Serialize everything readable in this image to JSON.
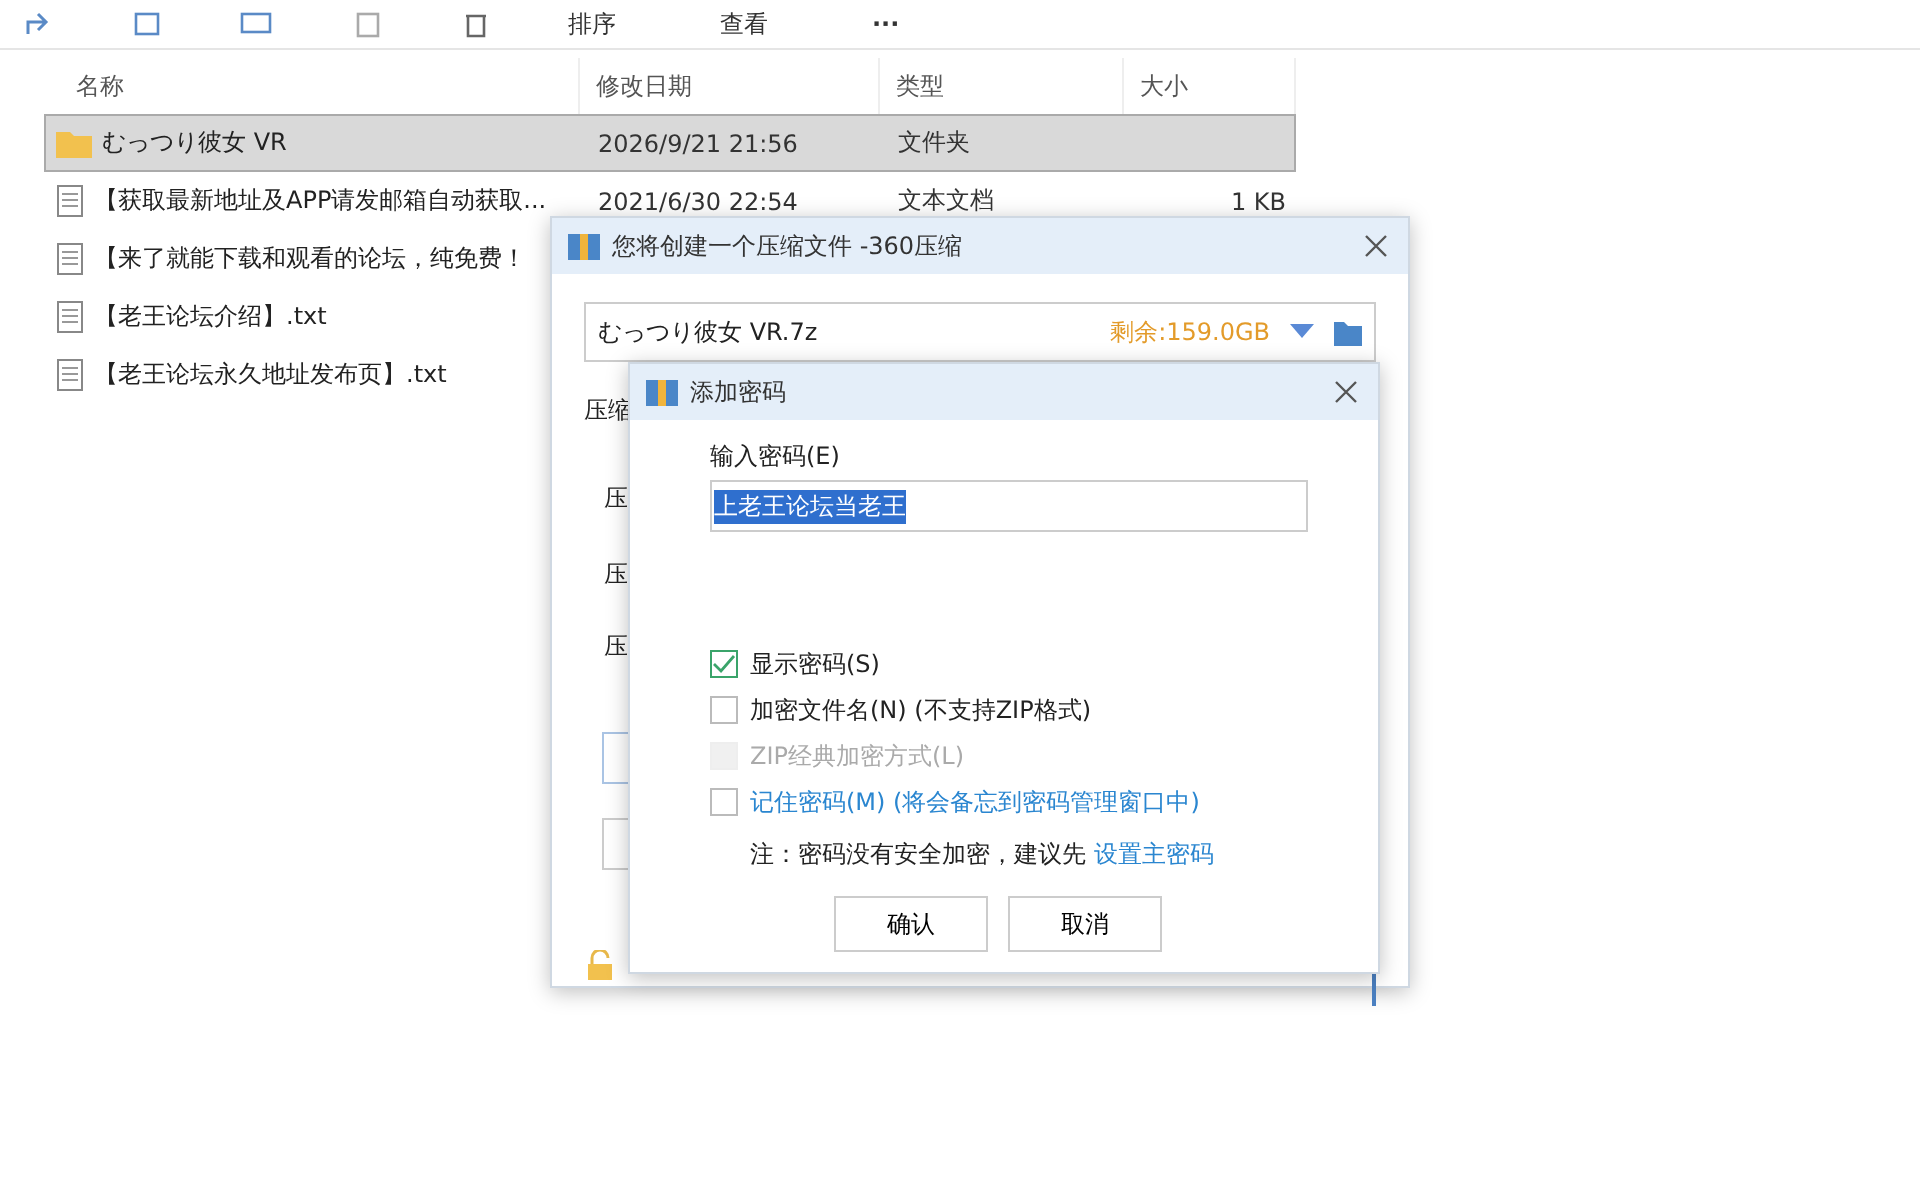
{
  "toolbar": {
    "items": [
      {
        "label": "排序"
      },
      {
        "label": "查看"
      }
    ],
    "more": "···"
  },
  "file_list": {
    "columns": [
      "名称",
      "修改日期",
      "类型",
      "大小"
    ],
    "rows": [
      {
        "kind": "folder",
        "name": "むっつり彼女 VR",
        "date": "2026/9/21 21:56",
        "type": "文件夹",
        "size": "",
        "selected": true
      },
      {
        "kind": "text",
        "name": "【获取最新地址及APP请发邮箱自动获取...",
        "date": "2021/6/30 22:54",
        "type": "文本文档",
        "size": "1 KB",
        "selected": false
      },
      {
        "kind": "text",
        "name": "【来了就能下载和观看的论坛，纯免费！",
        "date": "",
        "type": "",
        "size": "",
        "selected": false
      },
      {
        "kind": "text",
        "name": "【老王论坛介绍】.txt",
        "date": "",
        "type": "",
        "size": "",
        "selected": false
      },
      {
        "kind": "text",
        "name": "【老王论坛永久地址发布页】.txt",
        "date": "",
        "type": "",
        "size": "",
        "selected": false
      }
    ]
  },
  "compress_dialog": {
    "title": "您将创建一个压缩文件 -360压缩",
    "filename": "むっつり彼女 VR.7z",
    "free_space": "剩余:159.0GB",
    "labels": [
      "压缩",
      "压",
      "压",
      "压"
    ]
  },
  "password_dialog": {
    "title": "添加密码",
    "input_label": "输入密码(E)",
    "password": "上老王论坛当老王",
    "options": [
      {
        "kind": "plain",
        "label": "显示密码(S)",
        "checked": true,
        "disabled": false
      },
      {
        "kind": "plain",
        "label": "加密文件名(N) (不支持ZIP格式)",
        "checked": false,
        "disabled": false
      },
      {
        "kind": "plain",
        "label": "ZIP经典加密方式(L)",
        "checked": false,
        "disabled": true
      },
      {
        "kind": "link",
        "label": "记住密码(M) (将会备忘到密码管理窗口中)",
        "checked": false,
        "disabled": false
      }
    ],
    "note": "注：密码没有安全加密，建议先",
    "note_link": "设置主密码",
    "buttons": [
      "确认",
      "取消"
    ]
  }
}
